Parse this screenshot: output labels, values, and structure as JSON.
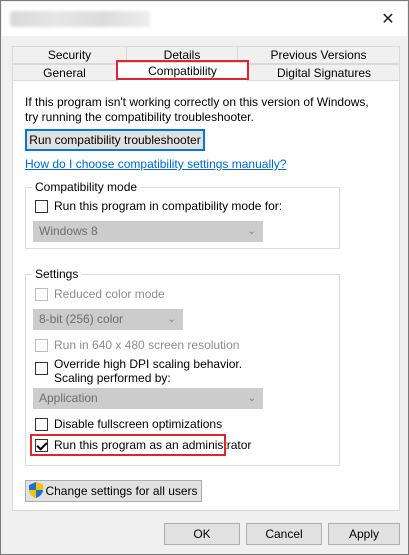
{
  "window": {
    "close_glyph": "✕"
  },
  "tabs": {
    "row1": [
      "Security",
      "Details",
      "Previous Versions"
    ],
    "row2": [
      "General",
      "Compatibility",
      "Digital Signatures"
    ]
  },
  "intro": {
    "text": "If this program isn't working correctly on this version of Windows, try running the compatibility troubleshooter.",
    "troubleshooter_button": "Run compatibility troubleshooter",
    "manual_link": "How do I choose compatibility settings manually?"
  },
  "compat_mode": {
    "legend": "Compatibility mode",
    "checkbox_label": "Run this program in compatibility mode for:",
    "checked": false,
    "os_selected": "Windows 8"
  },
  "settings": {
    "legend": "Settings",
    "reduced_color": {
      "label": "Reduced color mode",
      "checked": false,
      "enabled": false
    },
    "color_select": "8-bit (256) color",
    "resolution": {
      "label": "Run in 640 x 480 screen resolution",
      "checked": false,
      "enabled": false
    },
    "dpi": {
      "label_line1": "Override high DPI scaling behavior.",
      "label_line2": "Scaling performed by:",
      "checked": false
    },
    "dpi_select": "Application",
    "fullscreen": {
      "label": "Disable fullscreen optimizations",
      "checked": false
    },
    "admin": {
      "label": "Run this program as an administrator",
      "checked": true
    }
  },
  "change_all_button": "Change settings for all users",
  "footer": {
    "ok": "OK",
    "cancel": "Cancel",
    "apply": "Apply"
  },
  "colors": {
    "highlight": "#e0252b",
    "link": "#0066cc",
    "focus": "#0078d7"
  }
}
